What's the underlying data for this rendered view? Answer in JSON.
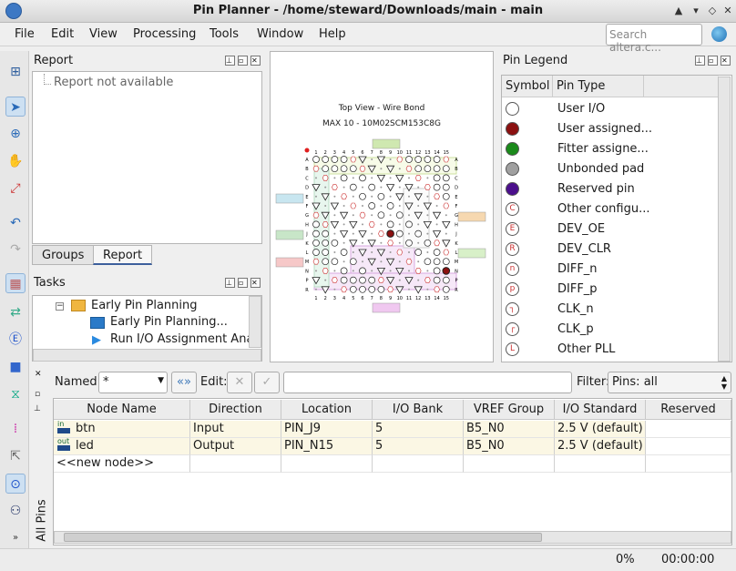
{
  "window": {
    "title": "Pin Planner - /home/steward/Downloads/main - main"
  },
  "menu": [
    "File",
    "Edit",
    "View",
    "Processing",
    "Tools",
    "Window",
    "Help"
  ],
  "search": {
    "placeholder": "Search altera.c..."
  },
  "report": {
    "title": "Report",
    "message": "Report not available",
    "tabs": [
      "Groups",
      "Report"
    ]
  },
  "tasks": {
    "title": "Tasks",
    "items": [
      "Early Pin Planning",
      "Early Pin Planning...",
      "Run I/O Assignment Analy"
    ]
  },
  "package_view": {
    "heading": "Top View - Wire Bond",
    "device": "MAX 10 - 10M02SCM153C8G",
    "columns": [
      "1",
      "2",
      "3",
      "4",
      "5",
      "6",
      "7",
      "8",
      "9",
      "10",
      "11",
      "12",
      "13",
      "14",
      "15"
    ],
    "rows": [
      "A",
      "B",
      "C",
      "D",
      "E",
      "F",
      "G",
      "H",
      "J",
      "K",
      "L",
      "M",
      "N",
      "P",
      "R"
    ]
  },
  "legend": {
    "title": "Pin Legend",
    "col_symbol": "Symbol",
    "col_type": "Pin Type",
    "items": [
      {
        "label": "User I/O",
        "color": "#ffffff",
        "glyph": ""
      },
      {
        "label": "User assigned...",
        "color": "#8b1010",
        "glyph": ""
      },
      {
        "label": "Fitter assigne...",
        "color": "#1a8a1a",
        "glyph": ""
      },
      {
        "label": "Unbonded pad",
        "color": "#a0a0a0",
        "glyph": ""
      },
      {
        "label": "Reserved pin",
        "color": "#4b0f8c",
        "glyph": ""
      },
      {
        "label": "Other configu...",
        "color": "#ffffff",
        "glyph": "C"
      },
      {
        "label": "DEV_OE",
        "color": "#ffffff",
        "glyph": "E"
      },
      {
        "label": "DEV_CLR",
        "color": "#ffffff",
        "glyph": "R"
      },
      {
        "label": "DIFF_n",
        "color": "#ffffff",
        "glyph": "n"
      },
      {
        "label": "DIFF_p",
        "color": "#ffffff",
        "glyph": "p"
      },
      {
        "label": "CLK_n",
        "color": "#ffffff",
        "glyph": "┐"
      },
      {
        "label": "CLK_p",
        "color": "#ffffff",
        "glyph": "┌"
      },
      {
        "label": "Other PLL",
        "color": "#ffffff",
        "glyph": "L"
      }
    ]
  },
  "filterbar": {
    "named_label": "Named:",
    "named_value": "*",
    "edit_label": "Edit:",
    "filter_label": "Filter:",
    "filter_value": "Pins: all"
  },
  "table": {
    "columns": [
      "Node Name",
      "Direction",
      "Location",
      "I/O Bank",
      "VREF Group",
      "I/O Standard",
      "Reserved"
    ],
    "rows": [
      {
        "icon": "in",
        "name": "btn",
        "direction": "Input",
        "location": "PIN_J9",
        "bank": "5",
        "vref": "B5_N0",
        "standard": "2.5 V (default)",
        "reserved": ""
      },
      {
        "icon": "out",
        "name": "led",
        "direction": "Output",
        "location": "PIN_N15",
        "bank": "5",
        "vref": "B5_N0",
        "standard": "2.5 V (default)",
        "reserved": ""
      }
    ],
    "new_node": "<<new node>>",
    "side_label": "All Pins"
  },
  "status": {
    "progress": "0%",
    "time": "00:00:00"
  }
}
